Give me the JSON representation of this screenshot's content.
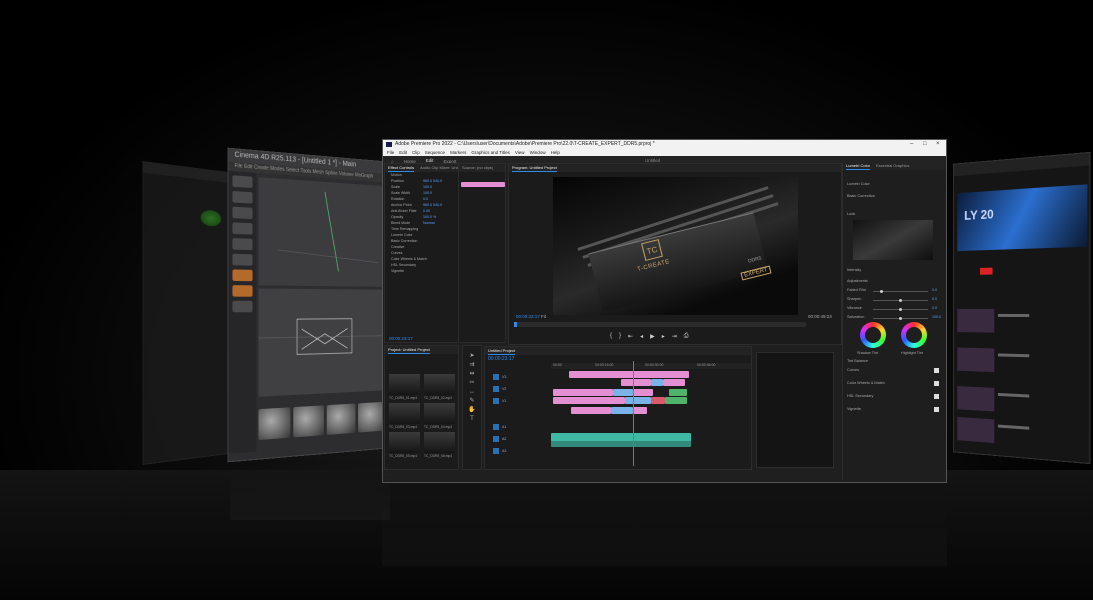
{
  "premiere": {
    "title": "Adobe Premiere Pro 2022 - C:\\Users\\user\\Documents\\Adobe\\Premiere Pro\\22.0\\T-CREATE_EXPERT_DDR5.prproj *",
    "menu": [
      "File",
      "Edit",
      "Clip",
      "Sequence",
      "Markers",
      "Graphics and Titles",
      "View",
      "Window",
      "Help"
    ],
    "workspaces": [
      "Home",
      "Edit",
      "Export"
    ],
    "sequence_title": "Untitled",
    "effect_tabs": [
      "Effect Controls",
      "Audio Clip Mixer: Untitled Project"
    ],
    "source_tab": "Source: (no clips)",
    "program_tab": "Program: Untitled Project",
    "lumetri_tabs": [
      "Lumetri Color",
      "Essential Graphics"
    ],
    "fx_rows": [
      {
        "label": "Motion",
        "val": ""
      },
      {
        "label": "Position",
        "val": "960.0  540.0"
      },
      {
        "label": "Scale",
        "val": "100.0"
      },
      {
        "label": "Scale Width",
        "val": "100.0"
      },
      {
        "label": "Rotation",
        "val": "0.0"
      },
      {
        "label": "Anchor Point",
        "val": "960.0  540.0"
      },
      {
        "label": "Anti-flicker Filter",
        "val": "0.00"
      },
      {
        "label": "Opacity",
        "val": "100.0 %"
      },
      {
        "label": "Blend Mode",
        "val": "Normal"
      },
      {
        "label": "Time Remapping",
        "val": ""
      },
      {
        "label": "Lumetri Color",
        "val": ""
      },
      {
        "label": "Basic Correction",
        "val": ""
      },
      {
        "label": "Creative",
        "val": ""
      },
      {
        "label": "Curves",
        "val": ""
      },
      {
        "label": "Color Wheels & Match",
        "val": ""
      },
      {
        "label": "HSL Secondary",
        "val": ""
      },
      {
        "label": "Vignette",
        "val": ""
      }
    ],
    "fx_timecode": "00:00:23:17",
    "program_tc_left": "00:00:23:17",
    "program_tc_right": "00:00:49:23",
    "fit": "Fit",
    "timeline_tab": "Untitled Project",
    "timeline_tc": "00:00:23:17",
    "ruler": [
      "00:00",
      "00:00:15:00",
      "00:00:30:00",
      "00:00:45:00"
    ],
    "video_tracks": [
      "V3",
      "V2",
      "V1"
    ],
    "audio_tracks": [
      "A1",
      "A2",
      "A3"
    ],
    "project_tab": "Project: Untitled Project",
    "project_items": [
      "TC_DDR5_01.mp4",
      "TC_DDR5_02.mp4",
      "TC_DDR5_03.mp4",
      "TC_DDR5_04.mp4",
      "TC_DDR5_05.mp4",
      "TC_DDR5_06.mp4"
    ],
    "lumetri": {
      "preset_label": "Lumetri Color",
      "basic": "Basic Correction",
      "look": "Look",
      "intensity": "Intensity",
      "adjustments": "Adjustments",
      "sliders": [
        {
          "label": "Faded Film",
          "val": "0.0",
          "pos": 0.15
        },
        {
          "label": "Sharpen",
          "val": "0.0",
          "pos": 0.5
        },
        {
          "label": "Vibrance",
          "val": "0.0",
          "pos": 0.5
        },
        {
          "label": "Saturation",
          "val": "100.0",
          "pos": 0.5
        }
      ],
      "shadow_tint": "Shadow Tint",
      "highlight_tint": "Highlight Tint",
      "tint_balance": "Tint Balance",
      "sections": [
        "Curves",
        "Color Wheels & Match",
        "HSL Secondary",
        "Vignette"
      ]
    },
    "video": {
      "brand": "TC",
      "brand_text": "T-CREATE",
      "ddr": "DDR5",
      "expert": "EXPERT"
    }
  },
  "c4d": {
    "title": "Cinema 4D R25.113 - [Untitled 1 *] - Main",
    "menu": "File  Edit  Create  Modes  Select  Tools  Mesh  Spline  Volume  MoGraph  Character"
  },
  "youtube": {
    "hero_text": "LY 20"
  },
  "colors": {
    "accent": "#2d8ceb",
    "clip_pink": "#e48fd1",
    "clip_blue": "#7ab3e8",
    "clip_green": "#4fb36a",
    "clip_teal": "#3fb9a3"
  }
}
